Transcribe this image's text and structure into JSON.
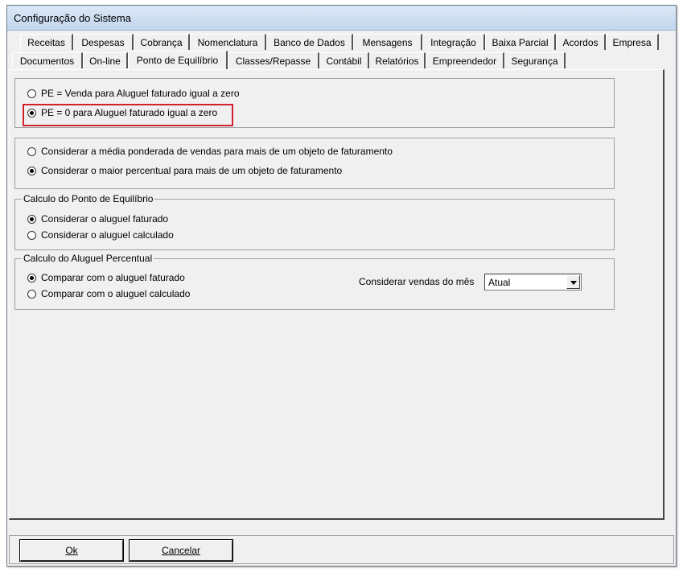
{
  "window": {
    "title": "Configuração do Sistema"
  },
  "tabs_row1": [
    "Receitas",
    "Despesas",
    "Cobrança",
    "Nomenclatura",
    "Banco de Dados",
    "Mensagens",
    "Integração",
    "Baixa Parcial",
    "Acordos",
    "Empresa"
  ],
  "tabs_row2": [
    "Documentos",
    "On-line",
    "Ponto de Equilíbrio",
    "Classes/Repasse",
    "Contábil",
    "Relatórios",
    "Empreendedor",
    "Segurança"
  ],
  "active_tab": "Ponto de Equilíbrio",
  "group1": {
    "options": [
      {
        "label": "PE = Venda para Aluguel faturado igual a zero",
        "selected": false
      },
      {
        "label": "PE = 0 para Aluguel faturado igual a zero",
        "selected": true
      }
    ]
  },
  "group2": {
    "options": [
      {
        "label": "Considerar a média ponderada de vendas para mais de um objeto de faturamento",
        "selected": false
      },
      {
        "label": "Considerar o maior percentual para mais de um objeto de faturamento",
        "selected": true
      }
    ]
  },
  "group3": {
    "title": "Calculo do Ponto de Equilíbrio",
    "options": [
      {
        "label": "Considerar o aluguel faturado",
        "selected": true
      },
      {
        "label": "Considerar o aluguel calculado",
        "selected": false
      }
    ]
  },
  "group4": {
    "title": "Calculo do Aluguel Percentual",
    "options": [
      {
        "label": "Comparar com o aluguel faturado",
        "selected": true
      },
      {
        "label": "Comparar com o aluguel calculado",
        "selected": false
      }
    ],
    "sales_month_label": "Considerar vendas do mês",
    "sales_month_value": "Atual"
  },
  "buttons": {
    "ok": "Ok",
    "cancel": "Cancelar"
  },
  "colors": {
    "highlight": "#d0212e",
    "title_bar": "#c3d6ee"
  }
}
